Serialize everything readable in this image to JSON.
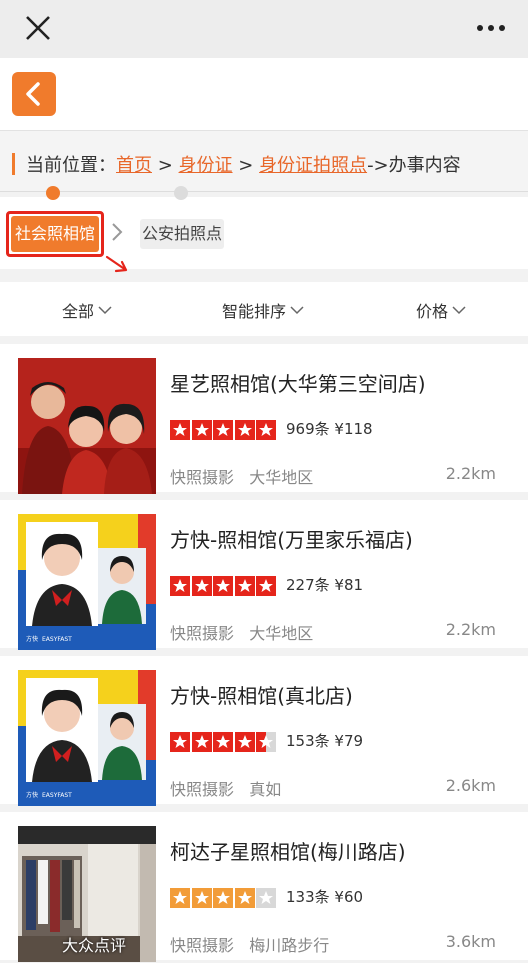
{
  "window": {
    "close_icon": "close-icon",
    "more_icon": "more-dots-icon"
  },
  "nav": {
    "back_icon": "chevron-left-icon",
    "accent_color": "#f07b2c"
  },
  "breadcrumb": {
    "prefix": "当前位置：",
    "home": "首页",
    "sep1": " > ",
    "idcard": "身份证",
    "sep2": " > ",
    "idphoto": "身份证拍照点",
    "suffix": "->办事内容"
  },
  "tabs": {
    "active": "社会照相馆",
    "inactive": "公安拍照点"
  },
  "filters": {
    "all": "全部",
    "sort": "智能排序",
    "price": "价格"
  },
  "shops": [
    {
      "name": "星艺照相馆(大华第三空间店)",
      "rating": 5,
      "reviews": "969条",
      "price": "¥118",
      "category": "快照摄影",
      "area": "大华地区",
      "distance": "2.2km"
    },
    {
      "name": "方快-照相馆(万里家乐福店)",
      "rating": 5,
      "reviews": "227条",
      "price": "¥81",
      "category": "快照摄影",
      "area": "大华地区",
      "distance": "2.2km"
    },
    {
      "name": "方快-照相馆(真北店)",
      "rating": 4.5,
      "reviews": "153条",
      "price": "¥79",
      "category": "快照摄影",
      "area": "真如",
      "distance": "2.6km"
    },
    {
      "name": "柯达子星照相馆(梅川路店)",
      "rating": 4,
      "reviews": "133条",
      "price": "¥60",
      "category": "快照摄影",
      "area": "梅川路步行",
      "distance": "3.6km"
    }
  ],
  "thumb_labels": {
    "brand": "方快",
    "brand_en": "EASYFAST",
    "watermark": "大众点评"
  },
  "colors": {
    "star_red": "#e5251b",
    "star_orange": "#f29c38",
    "star_empty": "#d8d8d8"
  }
}
